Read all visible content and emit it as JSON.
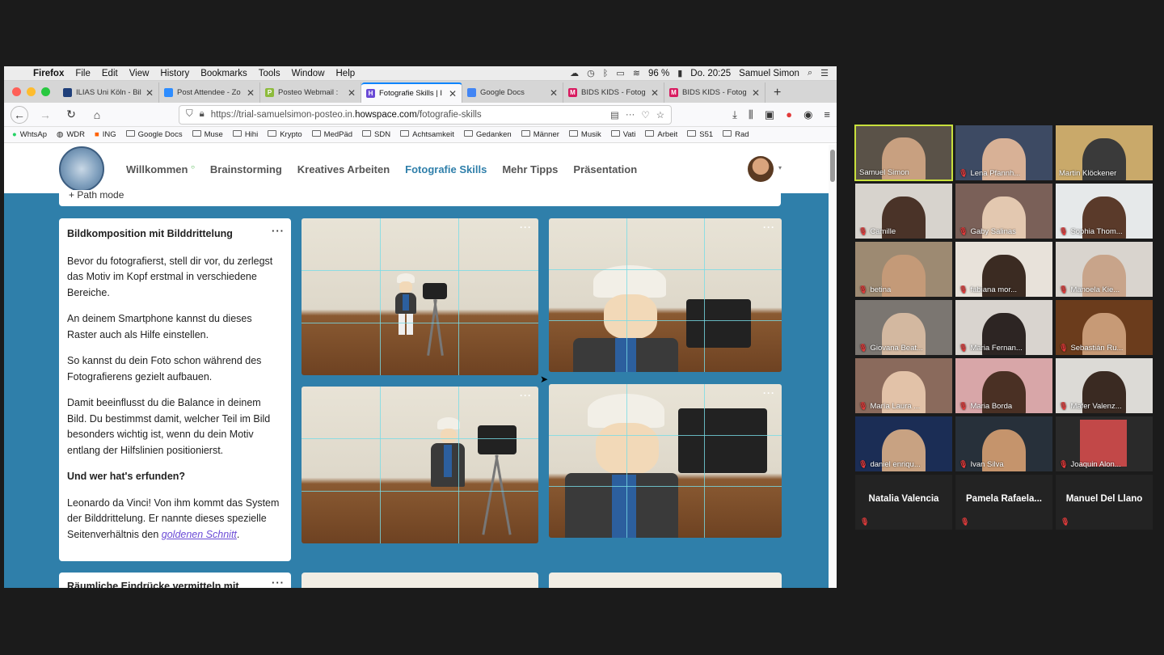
{
  "menubar": {
    "app": "Firefox",
    "items": [
      "File",
      "Edit",
      "View",
      "History",
      "Bookmarks",
      "Tools",
      "Window",
      "Help"
    ],
    "battery": "96 %",
    "clock": "Do. 20:25",
    "user": "Samuel Simon"
  },
  "tabs": [
    {
      "title": "ILIAS Uni Köln - Bil",
      "fav_color": "#1f3f7a",
      "fav": ""
    },
    {
      "title": "Post Attendee - Zo",
      "fav_color": "#2d8cff",
      "fav": ""
    },
    {
      "title": "Posteo Webmail :",
      "fav_color": "#8dbb3c",
      "fav": "P"
    },
    {
      "title": "Fotografie Skills | I",
      "fav_color": "#6a4ad6",
      "fav": "H",
      "active": true
    },
    {
      "title": "Google Docs",
      "fav_color": "#4285f4",
      "fav": ""
    },
    {
      "title": "BIDS KIDS - Fotog",
      "fav_color": "#d81b60",
      "fav": "M"
    },
    {
      "title": "BIDS KIDS - Fotog",
      "fav_color": "#d81b60",
      "fav": "M"
    }
  ],
  "url": {
    "prefix": "https://trial-samuelsimon-posteo.in.",
    "host": "howspace.com",
    "path": "/fotografie-skills"
  },
  "bookmarks": [
    "WhtsAp",
    "WDR",
    "ING",
    "Google Docs",
    "Muse",
    "Hihi",
    "Krypto",
    "MedPäd",
    "SDN",
    "Achtsamkeit",
    "Gedanken",
    "Männer",
    "Musik",
    "Vati",
    "Arbeit",
    "S51",
    "Rad"
  ],
  "site": {
    "nav": [
      "Willkommen",
      "Brainstorming",
      "Kreatives Arbeiten",
      "Fotografie Skills",
      "Mehr Tipps",
      "Präsentation"
    ],
    "active_nav": "Fotografie Skills",
    "path_mode": "Path mode"
  },
  "textcard": {
    "title": "Bildkomposition mit Bilddrittelung",
    "p1": "Bevor du fotografierst, stell dir vor, du zerlegst das Motiv im Kopf erstmal in verschiedene Bereiche.",
    "p2": "An deinem Smartphone kannst du dieses Raster auch als Hilfe einstellen.",
    "p3": "So kannst du dein Foto schon während des Fotografierens gezielt aufbauen.",
    "p4": "Damit beeinflusst du die Balance in deinem Bild. Du bestimmst damit, welcher Teil im Bild besonders wichtig ist, wenn du dein Motiv entlang der Hilfslinien positionierst.",
    "subheading": "Und wer hat's erfunden?",
    "p5": "Leonardo da Vinci! Von ihm kommt das System der Bilddrittelung. Er nannte dieses spezielle Seitenverhältnis den",
    "link": "goldenen Schnitt",
    "p5_end": "."
  },
  "card2_title": "Räumliche Eindrücke vermitteln mit",
  "participants": [
    {
      "name": "Samuel Simon",
      "active": true,
      "muted": false
    },
    {
      "name": "Lena Pfannh...",
      "muted": true
    },
    {
      "name": "Martin Klöckener",
      "muted": false
    },
    {
      "name": "Camille",
      "muted": true
    },
    {
      "name": "Gaby Salinas",
      "muted": true
    },
    {
      "name": "Sophia Thom...",
      "muted": true
    },
    {
      "name": "betina",
      "muted": true
    },
    {
      "name": "fabiana mor...",
      "muted": true
    },
    {
      "name": "Manoela Kie...",
      "muted": true
    },
    {
      "name": "Giovana Beat...",
      "muted": true
    },
    {
      "name": "Maria Fernan...",
      "muted": true
    },
    {
      "name": "Sebastián Ru...",
      "muted": true
    },
    {
      "name": "María Laura ...",
      "muted": true
    },
    {
      "name": "Maria Borda",
      "muted": true
    },
    {
      "name": "Mafer Valenz...",
      "muted": true
    },
    {
      "name": "daniel enriqu...",
      "muted": true
    },
    {
      "name": "Ivan Silva",
      "muted": true
    },
    {
      "name": "Joaquin Alon...",
      "muted": true
    },
    {
      "name": "Natalia Valencia",
      "muted": true,
      "no_video": true
    },
    {
      "name": "Pamela  Rafaela...",
      "muted": true,
      "no_video": true
    },
    {
      "name": "Manuel Del Llano",
      "muted": true,
      "no_video": true
    }
  ]
}
